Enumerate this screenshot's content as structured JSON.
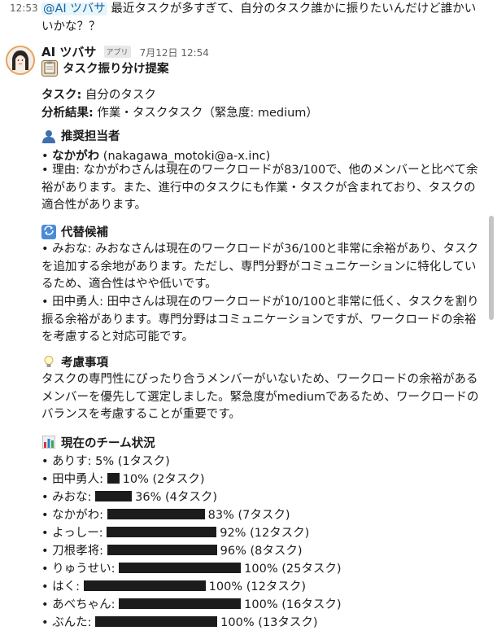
{
  "previous_message": {
    "time": "12:53",
    "mention": "@AI ツバサ",
    "text": " 最近タスクが多すぎて、自分のタスク誰かに振りたいんだけど誰かいいかな？？"
  },
  "message": {
    "sender": "AI ツバサ",
    "app_badge": "アプリ",
    "timestamp": "7月12日 12:54",
    "title": "タスク振り分け提案",
    "task_label": "タスク:",
    "task_value": " 自分のタスク",
    "analysis_label": "分析結果:",
    "analysis_value": " 作業・タスクタスク（緊急度: medium）",
    "recommended": {
      "heading": "推奨担当者",
      "person_name": "なかがわ",
      "person_email": " (nakagawa_motoki@a-x.inc)",
      "reason": "• 理由: なかがわさんは現在のワークロードが83/100で、他のメンバーと比べて余裕があります。また、進行中のタスクにも作業・タスクが含まれており、タスクの適合性があります。"
    },
    "alternatives": {
      "heading": "代替候補",
      "items": [
        "• みおな: みおなさんは現在のワークロードが36/100と非常に余裕があり、タスクを追加する余地があります。ただし、専門分野がコミュニケーションに特化しているため、適合性はやや低いです。",
        "• 田中勇人: 田中さんは現在のワークロードが10/100と非常に低く、タスクを割り振る余裕があります。専門分野はコミュニケーションですが、ワークロードの余裕を考慮すると対応可能です。"
      ]
    },
    "considerations": {
      "heading": "考慮事項",
      "text": "タスクの専門性にぴったり合うメンバーがいないため、ワークロードの余裕があるメンバーを優先して選定しました。緊急度がmediumであるため、ワークロードのバランスを考慮することが重要です。"
    },
    "team_status": {
      "heading": "現在のチーム状況",
      "members": [
        {
          "name": "• ありす: ",
          "blocks": 0,
          "stats": "5% (1タスク)"
        },
        {
          "name": "• 田中勇人: ",
          "blocks": 1,
          "stats": "10% (2タスク)"
        },
        {
          "name": "• みおな: ",
          "blocks": 3,
          "stats": "36% (4タスク)"
        },
        {
          "name": "• なかがわ: ",
          "blocks": 8,
          "stats": "83% (7タスク)"
        },
        {
          "name": "• よっしー: ",
          "blocks": 9,
          "stats": "92% (12タスク)"
        },
        {
          "name": "• 刀根孝将: ",
          "blocks": 9,
          "stats": "96% (8タスク)"
        },
        {
          "name": "• りゅうせい: ",
          "blocks": 10,
          "stats": "100% (25タスク)"
        },
        {
          "name": "• はく: ",
          "blocks": 10,
          "stats": "100% (12タスク)"
        },
        {
          "name": "• あべちゃん: ",
          "blocks": 10,
          "stats": "100% (16タスク)"
        },
        {
          "name": "• ぶんた: ",
          "blocks": 10,
          "stats": "100% (13タスク)"
        }
      ]
    }
  },
  "icons": {
    "title": "clipboard-icon",
    "recommended": "person-silhouette-icon",
    "alternatives": "arrows-cycle-icon",
    "considerations": "lightbulb-icon",
    "team_status": "bar-chart-icon"
  },
  "colors": {
    "mention_bg": "#e8f5fa",
    "mention_text": "#1264a3",
    "avatar_border": "#e8a35a"
  }
}
